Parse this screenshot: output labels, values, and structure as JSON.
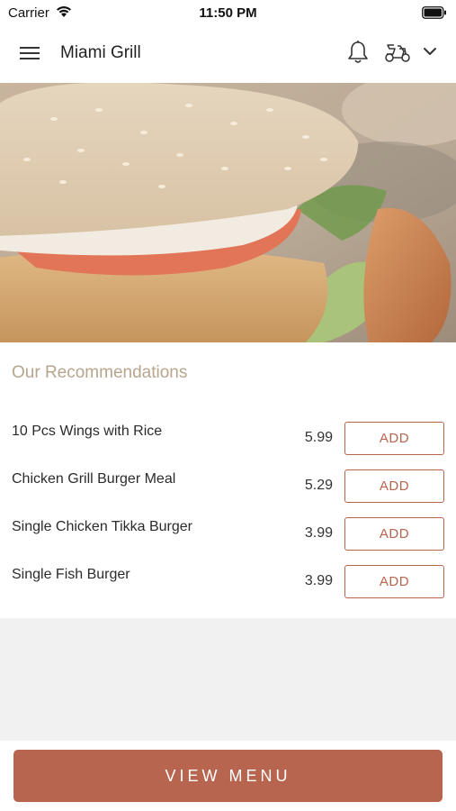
{
  "status_bar": {
    "carrier": "Carrier",
    "time": "11:50 PM"
  },
  "header": {
    "title": "Miami Grill"
  },
  "section": {
    "title": "Our Recommendations"
  },
  "recommendations": [
    {
      "name": "10 Pcs Wings with Rice",
      "price": "5.99",
      "button": "ADD"
    },
    {
      "name": "Chicken Grill Burger Meal",
      "price": "5.29",
      "button": "ADD"
    },
    {
      "name": "Single Chicken Tikka Burger",
      "price": "3.99",
      "button": "ADD"
    },
    {
      "name": "Single Fish Burger",
      "price": "3.99",
      "button": "ADD"
    }
  ],
  "footer": {
    "button": "VIEW MENU"
  },
  "colors": {
    "accent": "#b7654f",
    "section_title": "#b7a58d",
    "gray_bg": "#f1f1f1"
  }
}
